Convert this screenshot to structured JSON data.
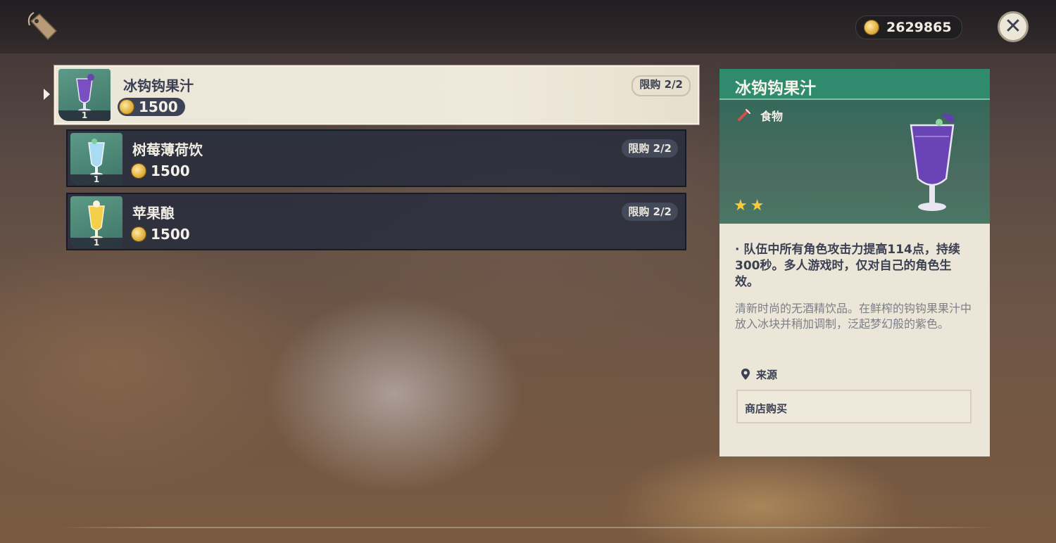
{
  "header": {
    "currency_amount": "2629865",
    "shop_icon": "price-tag-icon",
    "close_icon": "close-icon"
  },
  "items": [
    {
      "name": "冰钩钩果汁",
      "price": "1500",
      "limit": "限购 2/2",
      "quantity": "1",
      "drink_color": "#7a4fc2"
    },
    {
      "name": "树莓薄荷饮",
      "price": "1500",
      "limit": "限购 2/2",
      "quantity": "1",
      "drink_color": "#a9dcf2"
    },
    {
      "name": "苹果酿",
      "price": "1500",
      "limit": "限购 2/2",
      "quantity": "1",
      "drink_color": "#f4d048"
    }
  ],
  "detail": {
    "title": "冰钩钩果汁",
    "type": "食物",
    "rarity_stars": 2,
    "effect": "· 队伍中所有角色攻击力提高114点，持续300秒。多人游戏时，仅对自己的角色生效。",
    "description": "清新时尚的无酒精饮品。在鲜榨的钩钩果果汁中放入冰块并稍加调制，泛起梦幻般的紫色。",
    "source_label": "来源",
    "source_value": "商店购买"
  },
  "colors": {
    "detail_header": "#2f8a6e",
    "selected_bg": "#ece6d8",
    "item_bg": "#282e3c",
    "text_dark": "#3b4153",
    "star": "#f7cb3c"
  }
}
